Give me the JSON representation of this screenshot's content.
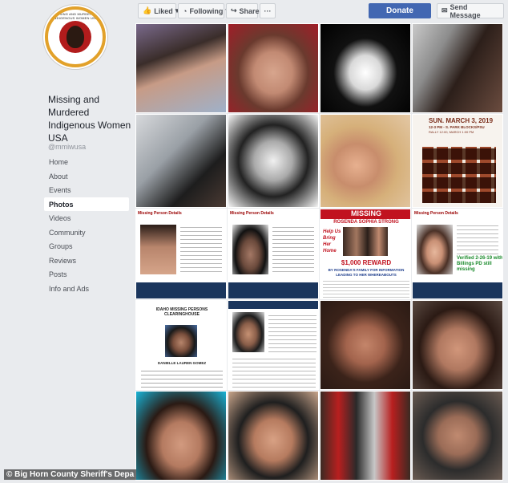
{
  "actions": {
    "liked": "Liked",
    "following": "Following",
    "share": "Share",
    "more": "···",
    "donate": "Donate",
    "message": "Send Message"
  },
  "page": {
    "logo_text": "MISSING AND MURDERED INDIGENOUS WOMEN USA",
    "name": "Missing and Murdered Indigenous Women USA",
    "handle": "@mmiwusa"
  },
  "nav": [
    {
      "label": "Home",
      "active": false
    },
    {
      "label": "About",
      "active": false
    },
    {
      "label": "Events",
      "active": false
    },
    {
      "label": "Photos",
      "active": true
    },
    {
      "label": "Videos",
      "active": false
    },
    {
      "label": "Community",
      "active": false
    },
    {
      "label": "Groups",
      "active": false
    },
    {
      "label": "Reviews",
      "active": false
    },
    {
      "label": "Posts",
      "active": false
    },
    {
      "label": "Info and Ads",
      "active": false
    }
  ],
  "photos": {
    "rally_title": "SUN. MARCH 3, 2019",
    "rally_sub": "12-3 PM - S. PARK BLOCKS/PSU",
    "rally_sub2": "RALLY 12:00, MARCH 1:00 PM",
    "missing_details": "Missing Person Details",
    "missing_banner": "MISSING",
    "missing_name": "ROSENDA SOPHIA STRONG",
    "help_text": "Help Us Bring Her Home",
    "reward": "$1,000 REWARD",
    "reward_sub": "BY ROSENDA'S FAMILY FOR INFORMATION LEADING TO HER WHEREABOUTS",
    "verified": "Verified 2-26-19 with Billings PD still missing",
    "clearinghouse": "IDAHO MISSING PERSONS CLEARINGHOUSE",
    "danielle": "DANIELLE LAUREN GOMEZ"
  },
  "watermark": "© Big Horn County Sheriff's Depa",
  "colors": {
    "accent": "#4267b2",
    "background": "#e9ebee",
    "logo_red": "#b21c1c",
    "logo_gold": "#e2a12a"
  }
}
